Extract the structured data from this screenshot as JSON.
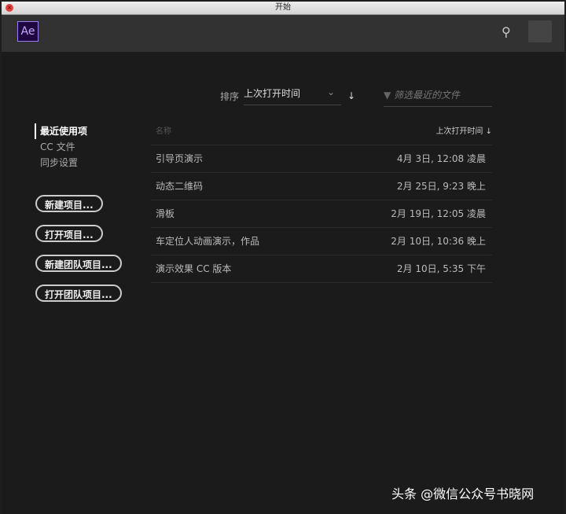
{
  "window": {
    "title": "开始"
  },
  "header": {
    "logo": "Ae"
  },
  "sort": {
    "label": "排序",
    "value": "上次打开时间"
  },
  "filter": {
    "placeholder": "筛选最近的文件"
  },
  "nav": [
    "最近使用项",
    "CC 文件",
    "同步设置"
  ],
  "buttons": [
    "新建项目...",
    "打开项目...",
    "新建团队项目...",
    "打开团队项目..."
  ],
  "table": {
    "col_name": "名称",
    "col_time": "上次打开时间",
    "rows": [
      {
        "name": "引导页演示",
        "time": "4月 3日, 12:08 凌晨"
      },
      {
        "name": "动态二维码",
        "time": "2月 25日, 9:23 晚上"
      },
      {
        "name": "滑板",
        "time": "2月 19日, 12:05 凌晨"
      },
      {
        "name": "车定位人动画演示，作品",
        "time": "2月 10日, 10:36 晚上"
      },
      {
        "name": "演示效果 CC 版本",
        "time": "2月 10日, 5:35 下午"
      }
    ]
  },
  "watermark": "头条 @微信公众号书晓网"
}
